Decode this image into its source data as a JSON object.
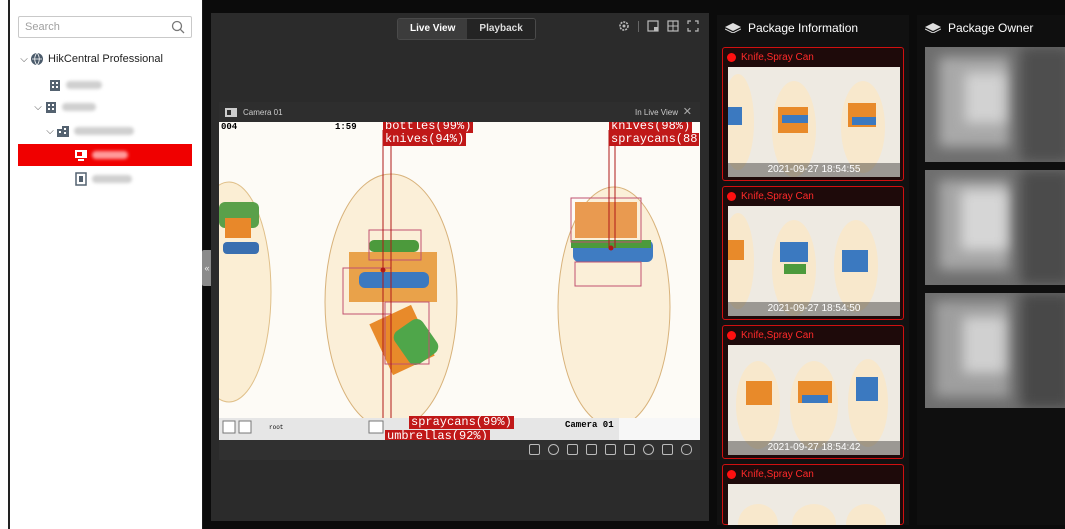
{
  "search": {
    "placeholder": "Search"
  },
  "tree": [
    {
      "label": "HikCentral Professional",
      "level": 0,
      "caret": "⌵",
      "icon": "site-icon",
      "selected": false
    },
    {
      "label": "",
      "level": 1,
      "caret": "",
      "icon": "building-icon",
      "selected": false
    },
    {
      "label": "",
      "level": 1,
      "caret": "⌵",
      "icon": "building-icon",
      "selected": false
    },
    {
      "label": "",
      "level": 2,
      "caret": "⌵",
      "icon": "area-icon",
      "selected": false
    },
    {
      "label": "",
      "level": 3,
      "caret": "",
      "icon": "camera-icon",
      "selected": true
    },
    {
      "label": "",
      "level": 3,
      "caret": "",
      "icon": "door-icon",
      "selected": false
    }
  ],
  "view_tabs": {
    "live": "Live View",
    "playback": "Playback"
  },
  "camera": {
    "name": "Camera 01",
    "status": "In Live View",
    "osd_left": "004",
    "osd_time": "1:59",
    "osd_camera": "Camera 01",
    "detections": [
      {
        "text": "bottles(99%)"
      },
      {
        "text": "knives(94%)"
      },
      {
        "text": "knives(98%)"
      },
      {
        "text": "spraycans(88"
      },
      {
        "text": "spraycans(99%)"
      },
      {
        "text": "umbrellas(92%)"
      }
    ],
    "toolbar_user": "root"
  },
  "package_info": {
    "title": "Package Information",
    "items": [
      {
        "label": "Knife,Spray Can",
        "time": "2021-09-27 18:54:55"
      },
      {
        "label": "Knife,Spray Can",
        "time": "2021-09-27 18:54:50"
      },
      {
        "label": "Knife,Spray Can",
        "time": "2021-09-27 18:54:42"
      },
      {
        "label": "Knife,Spray Can",
        "time": ""
      }
    ]
  },
  "package_owner": {
    "title": "Package Owner"
  },
  "colors": {
    "accent": "#f00000",
    "alert": "#d01010",
    "panel": "#2b2b2b"
  }
}
